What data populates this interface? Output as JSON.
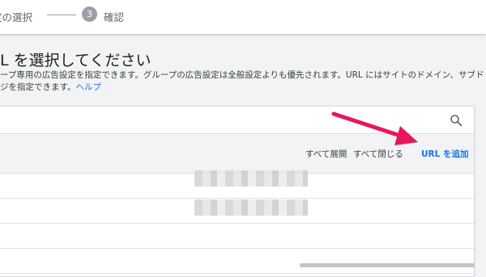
{
  "stepper": {
    "prev_step_label": "定の選択",
    "current_step_number": "3",
    "current_step_label": "確認"
  },
  "heading": {
    "title": "L を選択してください",
    "description_line1": "ープ専用の広告設定を指定できます。グループの広告設定は全般設定よりも優先されます。URL にはサイトのドメイン、サブド",
    "description_line2": "ジを指定できます。",
    "help_link": "ヘルプ"
  },
  "toolbar": {
    "expand_all": "すべて展開",
    "collapse_all": "すべて閉じる",
    "add_url": "URL を追加"
  },
  "colors": {
    "accent": "#1a73e8",
    "annotation_arrow": "#e8175d"
  },
  "icons": {
    "search": "search-icon"
  }
}
